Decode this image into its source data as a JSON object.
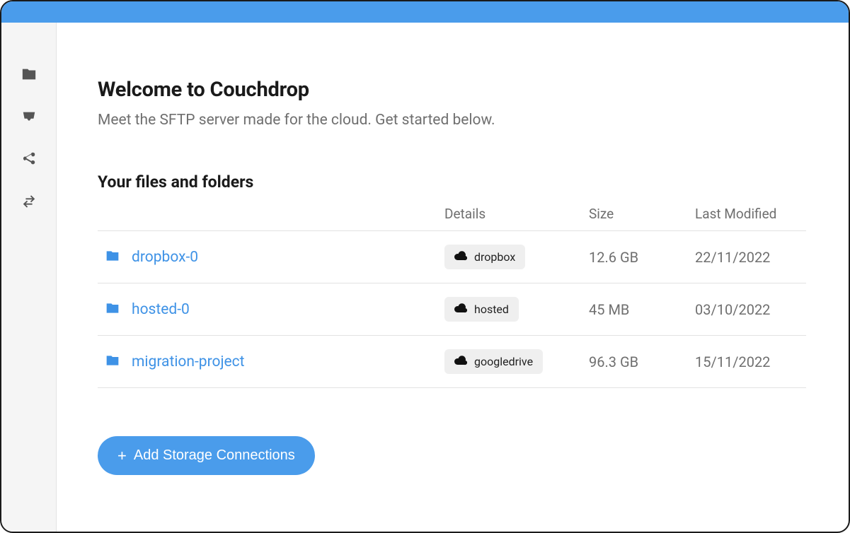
{
  "header": {
    "title": "Welcome to Couchdrop",
    "subtitle": "Meet the SFTP server made for the cloud. Get started below."
  },
  "sidebar": {
    "items": [
      {
        "name": "files",
        "icon": "folder"
      },
      {
        "name": "inbox",
        "icon": "inbox"
      },
      {
        "name": "share",
        "icon": "share"
      },
      {
        "name": "transfer",
        "icon": "transfer"
      }
    ]
  },
  "files_section": {
    "title": "Your files and folders",
    "columns": {
      "name": "",
      "details": "Details",
      "size": "Size",
      "modified": "Last Modified"
    },
    "rows": [
      {
        "name": "dropbox-0",
        "provider": "dropbox",
        "size": "12.6 GB",
        "modified": "22/11/2022"
      },
      {
        "name": "hosted-0",
        "provider": "hosted",
        "size": "45 MB",
        "modified": "03/10/2022"
      },
      {
        "name": "migration-project",
        "provider": "googledrive",
        "size": "96.3 GB",
        "modified": "15/11/2022"
      }
    ]
  },
  "actions": {
    "add_storage": "Add Storage Connections"
  }
}
